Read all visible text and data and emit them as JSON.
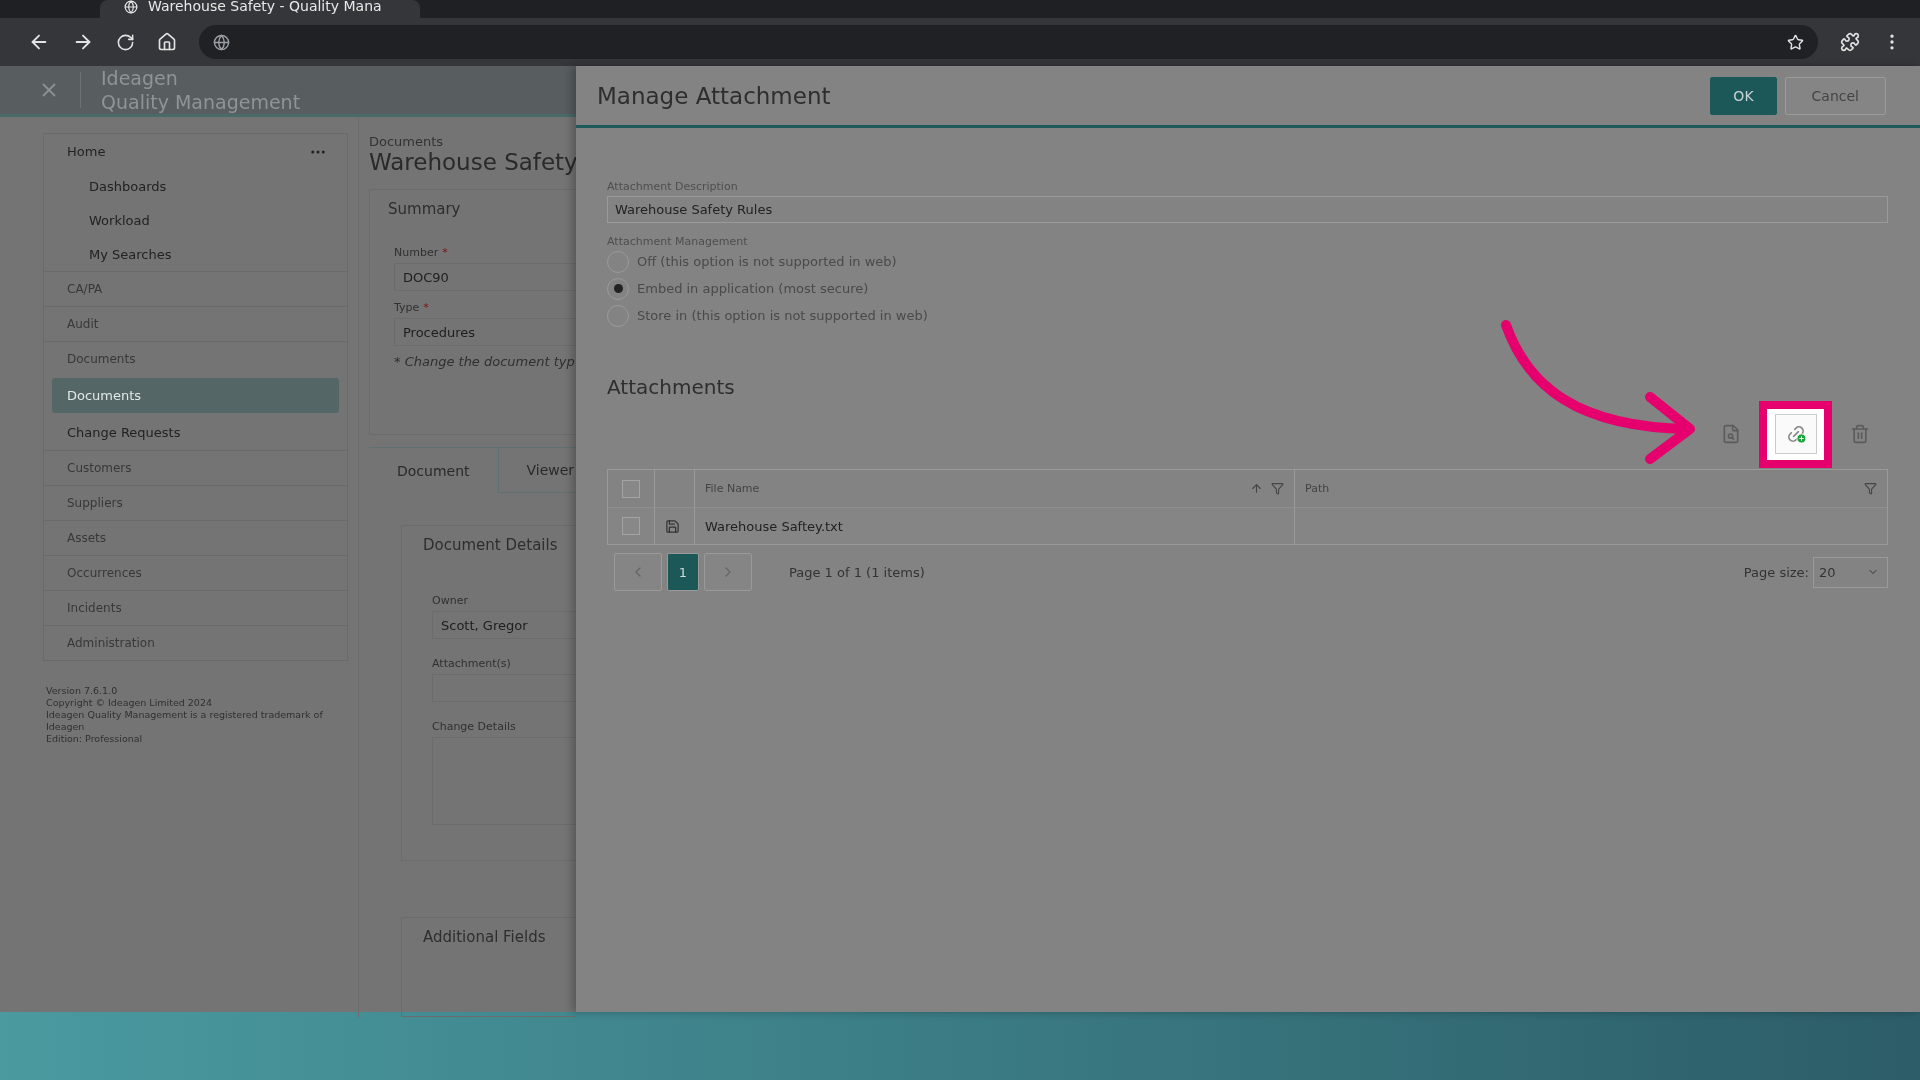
{
  "browser": {
    "tab_title": "Warehouse Safety - Quality Mana"
  },
  "app": {
    "brand": "Ideagen",
    "product": "Quality Management",
    "nav": [
      {
        "label": "Home",
        "kind": "header",
        "selected": false
      },
      {
        "label": "Dashboards",
        "kind": "sub",
        "selected": false
      },
      {
        "label": "Workload",
        "kind": "sub",
        "selected": false
      },
      {
        "label": "My Searches",
        "kind": "sub",
        "selected": false
      },
      {
        "label": "CA/PA",
        "kind": "module",
        "selected": false
      },
      {
        "label": "Audit",
        "kind": "module",
        "selected": false
      },
      {
        "label": "Documents",
        "kind": "module",
        "selected": false
      },
      {
        "label": "Documents",
        "kind": "page",
        "selected": true
      },
      {
        "label": "Change Requests",
        "kind": "page",
        "selected": false
      },
      {
        "label": "Customers",
        "kind": "module",
        "selected": false
      },
      {
        "label": "Suppliers",
        "kind": "module",
        "selected": false
      },
      {
        "label": "Assets",
        "kind": "module",
        "selected": false
      },
      {
        "label": "Occurrences",
        "kind": "module",
        "selected": false
      },
      {
        "label": "Incidents",
        "kind": "module",
        "selected": false
      },
      {
        "label": "Administration",
        "kind": "module",
        "selected": false
      }
    ],
    "footer": [
      "Version 7.6.1.0",
      "Copyright © Ideagen Limited 2024",
      "Ideagen Quality Management is a registered trademark of Ideagen",
      "Edition: Professional"
    ]
  },
  "record": {
    "breadcrumb": "Documents",
    "title": "Warehouse Safety",
    "summary": {
      "heading": "Summary",
      "fields": [
        {
          "label": "Number",
          "marker": "*",
          "value": "DOC90"
        },
        {
          "label": "Type",
          "marker": "*",
          "value": "Procedures"
        }
      ],
      "note": "* Change the document typ"
    },
    "tabs": [
      {
        "label": "Document",
        "selected": true
      },
      {
        "label": "Viewer",
        "selected": false
      }
    ],
    "details": {
      "heading": "Document Details",
      "fields": [
        {
          "label": "Owner",
          "value": "Scott, Gregor",
          "kind": "input"
        },
        {
          "label": "Attachment(s)",
          "kind": "input"
        },
        {
          "label": "Change Details",
          "kind": "textarea"
        }
      ]
    },
    "additional": {
      "heading": "Additional Fields"
    }
  },
  "dialog": {
    "title": "Manage Attachment",
    "buttons": [
      {
        "label": "OK",
        "kind": "primary"
      },
      {
        "label": "Cancel",
        "kind": "secondary"
      }
    ],
    "description": {
      "label": "Attachment Description",
      "value": "Warehouse Safety Rules"
    },
    "management": {
      "label": "Attachment Management",
      "options": [
        {
          "label": "Off (this option is not supported in web)",
          "selected": false
        },
        {
          "label": "Embed in application (most secure)",
          "selected": true
        },
        {
          "label": "Store in (this option is not supported in web)",
          "selected": false
        }
      ]
    },
    "attachments": {
      "heading": "Attachments",
      "select_all_checked": false,
      "columns": [
        {
          "label": "File Name",
          "sortable": true
        },
        {
          "label": "Path",
          "sortable": false
        }
      ],
      "rows": [
        {
          "file_name": "Warehouse Saftey.txt",
          "checked": false
        }
      ],
      "pager": {
        "pages": [
          {
            "label": "1",
            "selected": true
          }
        ],
        "summary": "Page 1 of 1 (1 items)",
        "page_size_label": "Page size:",
        "page_size": "20"
      }
    }
  }
}
